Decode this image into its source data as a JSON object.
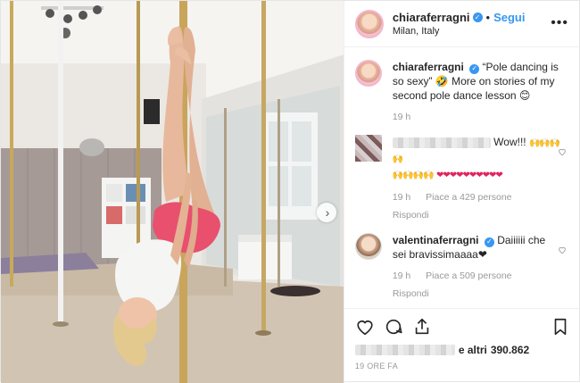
{
  "post": {
    "username": "chiaraferragni",
    "follow_label": "Segui",
    "location": "Milan, Italy",
    "more_label": "•••",
    "separator": "•"
  },
  "caption": {
    "username": "chiaraferragni",
    "text": "“Pole dancing is so sexy” 🤣 More on stories of my second pole dance lesson 😊",
    "time": "19 h"
  },
  "comments": [
    {
      "text": "Wow!!!",
      "time": "19 h",
      "likes": "Piace a 429 persone",
      "reply": "Rispondi",
      "hearts": "❤❤❤❤❤❤❤❤❤❤",
      "hands": "🙌🙌🙌🙌"
    },
    {
      "username": "valentinaferragni",
      "text": "Daiiiiii che sei bravissimaaaa❤",
      "time": "19 h",
      "likes": "Piace a 509 persone",
      "reply": "Rispondi"
    }
  ],
  "likes_summary": {
    "connector": "e altri",
    "count": "390.862"
  },
  "timestamp": "19 ORE FA",
  "icons": {
    "verified": "verified-badge-icon",
    "heart": "heart-icon",
    "comment": "comment-icon",
    "share": "share-icon",
    "save": "bookmark-icon",
    "next": "chevron-right-icon"
  },
  "colors": {
    "link": "#3897f0",
    "muted": "#999999",
    "text": "#262626"
  }
}
